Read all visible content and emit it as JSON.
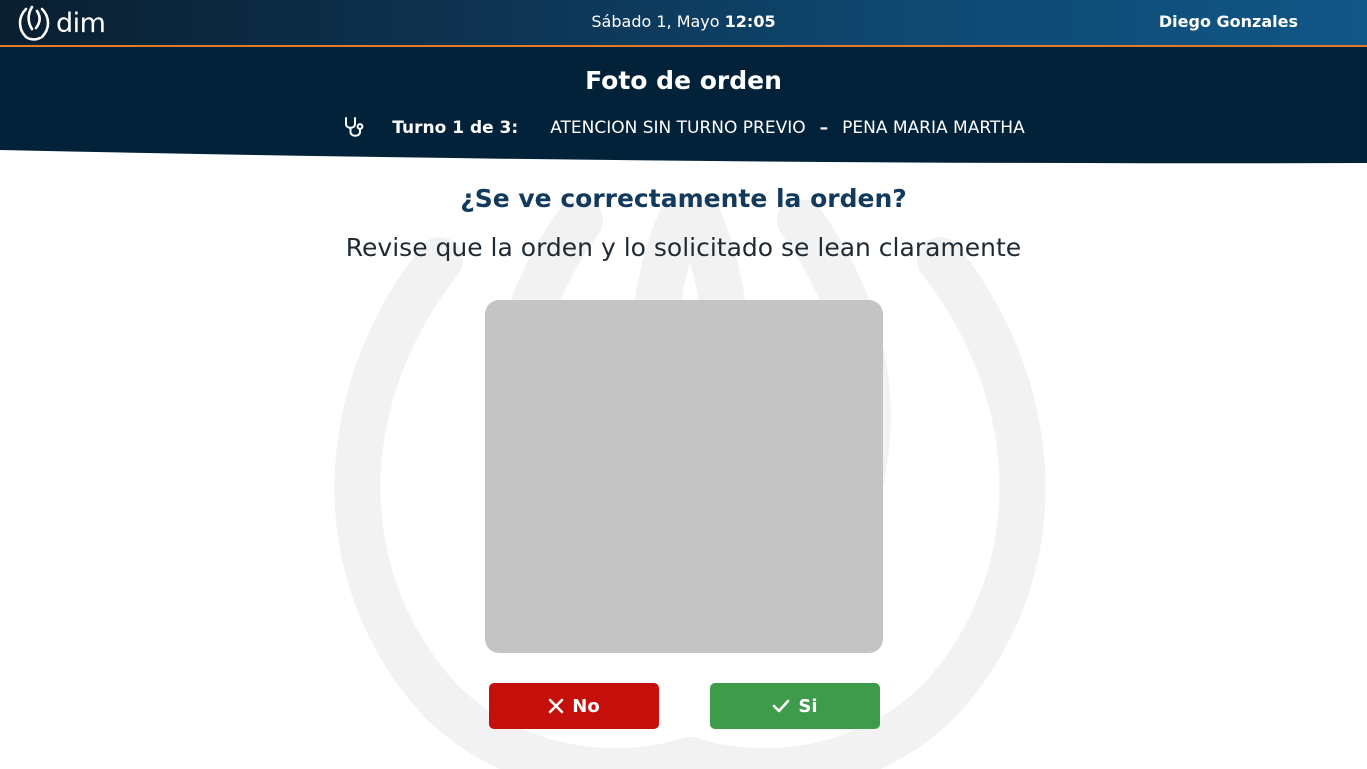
{
  "topbar": {
    "logo_text": "dim",
    "date": "Sábado 1, Mayo",
    "time": "12:05",
    "user_name": "Diego Gonzales"
  },
  "header": {
    "title": "Foto de orden",
    "turno_label": "Turno 1 de 3:",
    "turno_service": "ATENCION SIN TURNO PREVIO",
    "separator": "–",
    "turno_patient": "PENA MARIA MARTHA",
    "icon": "stethoscope-icon"
  },
  "main": {
    "question": "¿Se ve correctamente la orden?",
    "instruction": "Revise que la orden y lo solicitado se lean claramente"
  },
  "buttons": {
    "no_label": "No",
    "si_label": "Si"
  },
  "colors": {
    "header_bg": "#02223a",
    "topbar_accent": "#e07b2a",
    "question_text": "#123a5c",
    "photo_placeholder": "#c4c4c4",
    "no_button": "#c40f0a",
    "si_button": "#3e9b4c"
  }
}
